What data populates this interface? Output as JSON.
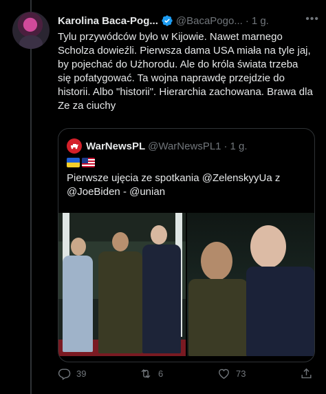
{
  "tweet": {
    "display_name": "Karolina Baca-Pog...",
    "handle": "@BacaPogo...",
    "separator": "·",
    "time": "1 g.",
    "text": "Tylu przywódców było w Kijowie. Nawet marnego Scholza dowieźli. Pierwsza dama USA miała na tyle jaj, by pojechać do Użhorodu. Ale do króla świata trzeba się pofatygować. Ta wojna naprawdę przejdzie do historii. Albo \"historii\". Hierarchia zachowana. Brawa dla Ze za ciuchy",
    "more_icon": "more-horizontal-icon"
  },
  "quoted": {
    "display_name": "WarNewsPL",
    "handle": "@WarNewsPL1",
    "separator": "·",
    "time": "1 g.",
    "flags": [
      "ukraine-flag-icon",
      "usa-flag-icon"
    ],
    "text": "Pierwsze ujęcia ze spotkania @ZelenskyyUa z @JoeBiden - @unian"
  },
  "actions": {
    "reply_count": "39",
    "retweet_count": "6",
    "like_count": "73",
    "share_icon": "share-icon"
  },
  "colors": {
    "background": "#000000",
    "text": "#e7e9ea",
    "muted": "#71767b",
    "verified": "#1d9bf0",
    "border": "#2f3336"
  }
}
